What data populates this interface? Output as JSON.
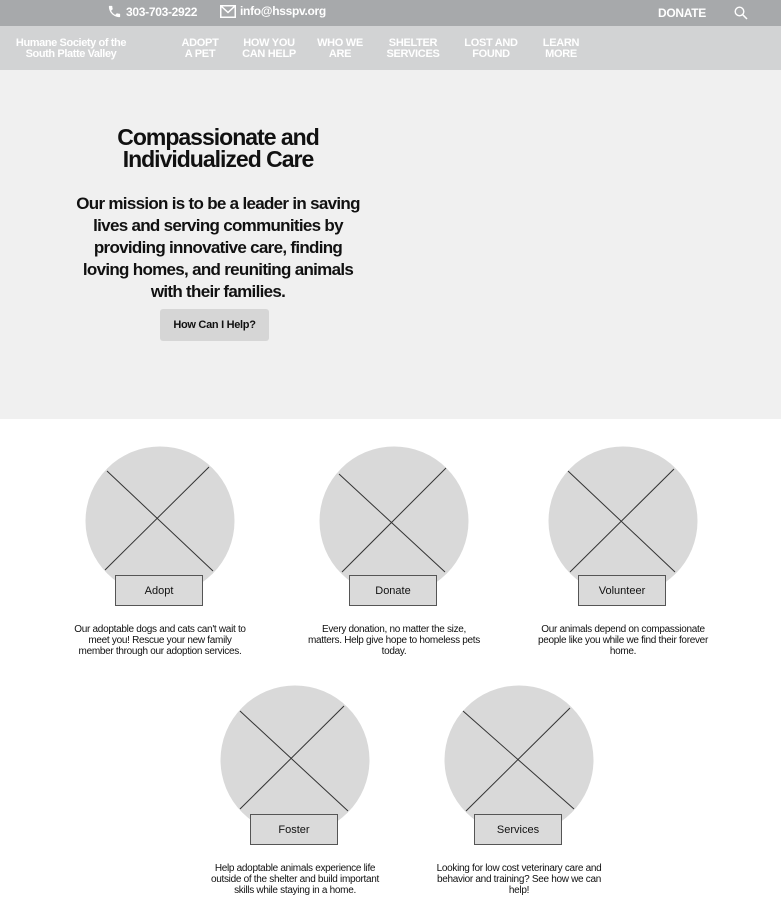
{
  "topbar": {
    "phone": "303-703-2922",
    "email": "info@hsspv.org",
    "donate_label": "DONATE",
    "search_icon": "search-icon"
  },
  "nav": {
    "brand": "Humane Society of the\nSouth Platte Valley",
    "items": [
      "ADOPT\nA PET",
      "HOW YOU\nCAN HELP",
      "WHO WE\nARE",
      "SHELTER\nSERVICES",
      "LOST AND\nFOUND",
      "LEARN\nMORE"
    ]
  },
  "hero": {
    "title": "Compassionate and Individualized Care",
    "mission": "Our mission is to be a leader in saving lives and serving communities by providing innovative care, finding loving homes, and reuniting animals with their families.",
    "button_label": "How Can I Help?"
  },
  "cards": [
    {
      "label": "Adopt",
      "text": "Our adoptable dogs and cats can't wait to meet you! Rescue your new family member through our adoption services."
    },
    {
      "label": "Donate",
      "text": "Every donation, no matter the size, matters. Help give hope to homeless pets today."
    },
    {
      "label": "Volunteer",
      "text": "Our animals depend on compassionate people like you while we find their forever home."
    },
    {
      "label": "Foster",
      "text": "Help adoptable animals experience life outside of the shelter and build important skills while staying in a home."
    },
    {
      "label": "Services",
      "text": "Looking for low cost veterinary care and behavior and training? See how we can help!"
    }
  ],
  "colors": {
    "topbar_bg": "#a7a9ab",
    "nav_bg": "#d2d3d4",
    "hero_bg": "#f0f0f0",
    "placeholder": "#d9d9d9"
  }
}
